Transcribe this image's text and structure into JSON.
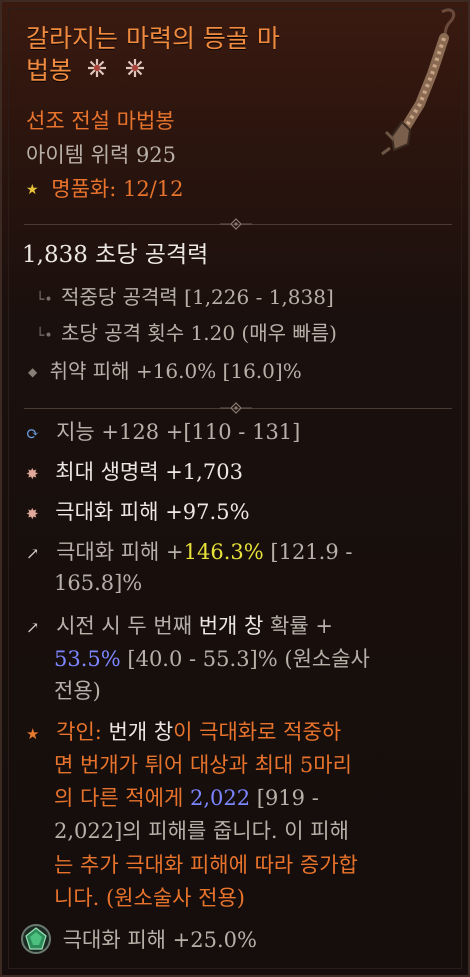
{
  "item": {
    "name_line1": "갈라지는 마력의 등골 마",
    "name_line2": "법봉",
    "type": "선조 전설 마법봉",
    "item_power": "아이템 위력 925",
    "masterwork_label": "명품화: 12/12"
  },
  "base": {
    "dps": "1,838 초당 공격력",
    "damage_per_hit": "적중당 공격력 [1,226 - 1,838]",
    "attacks_per_second": "초당 공격 횟수 1.20 (매우 빠름)",
    "vulnerable": "취약 피해 +16.0% [16.0]%"
  },
  "affixes": [
    {
      "line1": "지능 +128 +[110 - 131]"
    },
    {
      "line1": "최대 생명력 +1,703"
    },
    {
      "line1": "극대화 피해 +97.5%"
    },
    {
      "line1_a": "극대화 피해 +",
      "line1_b": "146.3%",
      "line1_c": " [121.9 -",
      "line2": "165.8]%"
    },
    {
      "line1_a": "시전 시 두 번째 ",
      "line1_b": "번개 창",
      "line1_c": " 확률 +",
      "line2_a": "53.5%",
      "line2_b": " [40.0 - 55.3]% (원소술사",
      "line3": "전용)"
    }
  ],
  "aspect": {
    "label": "각인: ",
    "skill": "번개 창",
    "text1": "이 극대화로 적중하",
    "line2": "면 번개가 튀어 대상과 최대 5마리",
    "line3_a": "의 다른 적에게 ",
    "line3_b": "2,022",
    "line3_c": " [919 -",
    "line4": "2,022]의 피해를 줍니다. 이 피해",
    "line5": "는 추가 극대화 피해에 따라 증가합",
    "line6": "니다. (원소술사 전용)"
  },
  "gem": {
    "text": "극대화 피해 +25.0%"
  },
  "colors": {
    "title": "#f08a3e",
    "aspect": "#e8732c",
    "highlight": "#e8e23a",
    "blue": "#7b86ff"
  }
}
